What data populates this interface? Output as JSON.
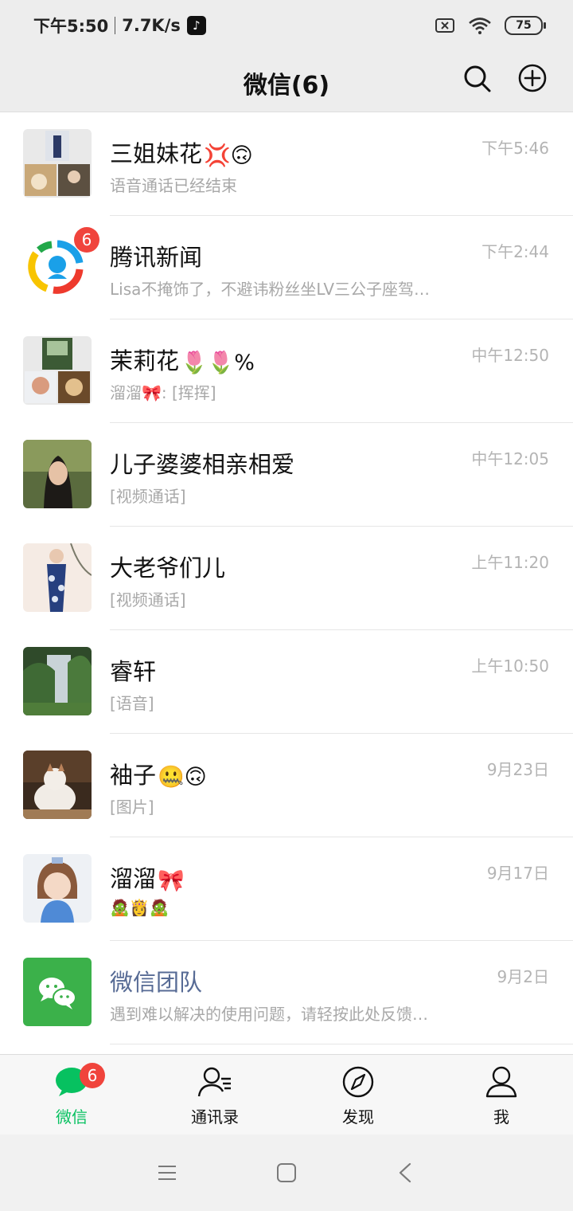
{
  "status_bar": {
    "time": "下午5:50",
    "network_speed": "7.7K/s",
    "battery": "75"
  },
  "header": {
    "title": "微信(6)",
    "icons": [
      "search-icon",
      "plus-circle-icon"
    ]
  },
  "chats": [
    {
      "name": "三姐妹花",
      "emoji": "💢🙃",
      "preview": "语音通话已经结束",
      "time": "下午5:46",
      "badge": ""
    },
    {
      "name": "腾讯新闻",
      "emoji": "",
      "preview": "Lisa不掩饰了，不避讳粉丝坐LV三公子座驾…",
      "time": "下午2:44",
      "badge": "6"
    },
    {
      "name": "茉莉花",
      "emoji": "🌷🌷%",
      "preview": "溜溜🎀: [挥挥]",
      "time": "中午12:50",
      "badge": ""
    },
    {
      "name": "儿子婆婆相亲相爱",
      "emoji": "",
      "preview": "[视频通话]",
      "time": "中午12:05",
      "badge": ""
    },
    {
      "name": "大老爷们儿",
      "emoji": "",
      "preview": "[视频通话]",
      "time": "上午11:20",
      "badge": ""
    },
    {
      "name": "睿轩",
      "emoji": "",
      "preview": "[语音]",
      "time": "上午10:50",
      "badge": ""
    },
    {
      "name": "袖子",
      "emoji": "🤐🙃",
      "preview": "[图片]",
      "time": "9月23日",
      "badge": ""
    },
    {
      "name": "溜溜",
      "emoji": "🎀",
      "preview": "🧟👸🧟",
      "time": "9月17日",
      "badge": ""
    },
    {
      "name": "微信团队",
      "emoji": "",
      "preview": "遇到难以解决的使用问题，请轻按此处反馈…",
      "time": "9月2日",
      "badge": ""
    }
  ],
  "tabs": [
    {
      "label": "微信",
      "icon": "chat-bubble-icon",
      "badge": "6",
      "active": true
    },
    {
      "label": "通讯录",
      "icon": "contacts-icon",
      "badge": "",
      "active": false
    },
    {
      "label": "发现",
      "icon": "compass-icon",
      "badge": "",
      "active": false
    },
    {
      "label": "我",
      "icon": "profile-icon",
      "badge": "",
      "active": false
    }
  ],
  "colors": {
    "accent_green": "#07c160",
    "badge_red": "#f0443c",
    "header_bg": "#ededed",
    "team_name": "#576b95"
  }
}
